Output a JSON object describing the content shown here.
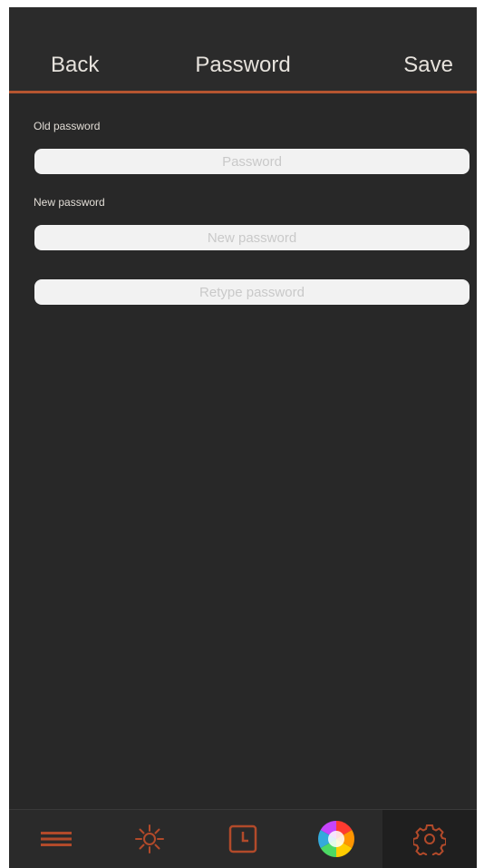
{
  "header": {
    "back_label": "Back",
    "title": "Password",
    "save_label": "Save"
  },
  "form": {
    "old_password_label": "Old password",
    "old_password_placeholder": "Password",
    "new_password_label": "New password",
    "new_password_placeholder": "New password",
    "retype_placeholder": "Retype password"
  },
  "tabbar": {
    "items": [
      {
        "icon": "menu-icon",
        "active": false
      },
      {
        "icon": "brightness-icon",
        "active": false
      },
      {
        "icon": "clock-icon",
        "active": false
      },
      {
        "icon": "color-wheel-icon",
        "active": false
      },
      {
        "icon": "gear-icon",
        "active": true
      }
    ]
  },
  "colors": {
    "accent": "#b55530",
    "background": "#282828",
    "header_text": "#e6e2dc"
  }
}
